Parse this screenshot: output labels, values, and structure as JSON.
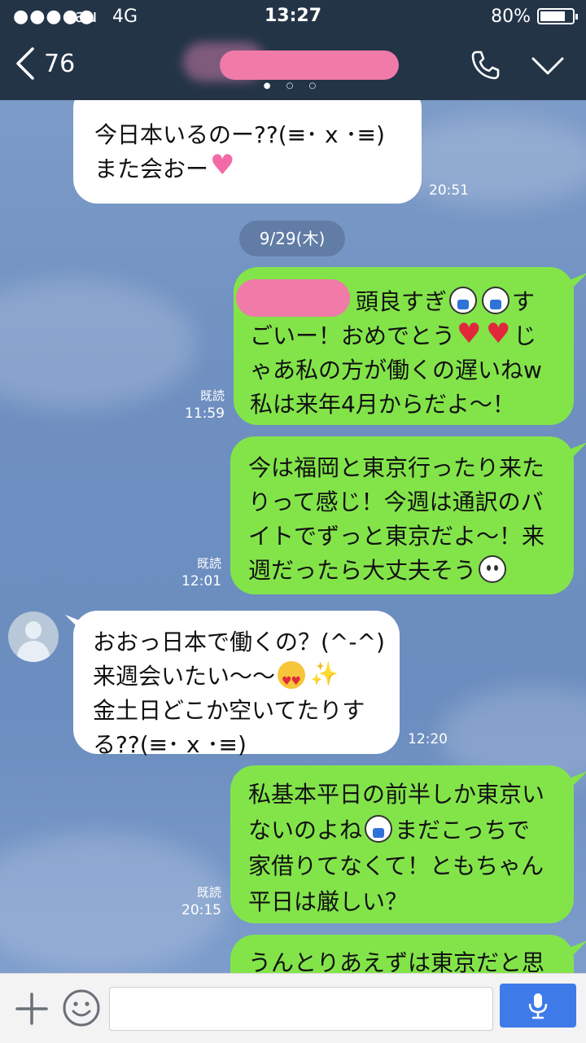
{
  "status_bar": {
    "signal": "●●●●●",
    "carrier": "au",
    "network": "4G",
    "time": "13:27",
    "battery_percent_label": "80%",
    "battery_level": 0.8
  },
  "nav": {
    "back_count": "76",
    "page_dots": "● ○ ○"
  },
  "chat": {
    "messages": [
      {
        "direction": "in",
        "lines": [
          "今日本いるのー??(≡･ x ･≡)",
          "また会おー"
        ],
        "time": "20:51"
      },
      {
        "type": "date",
        "label": "9/29(木)"
      },
      {
        "direction": "out",
        "lines": [
          "頭良すぎ",
          "す",
          "ごいー！おめでとう",
          "じ",
          "ゃあ私の方が働くの遅いねw",
          "私は来年4月からだよ〜！"
        ],
        "read": "既読",
        "time": "11:59"
      },
      {
        "direction": "out",
        "lines": [
          "今は福岡と東京行ったり来た",
          "りって感じ！今週は通訳のバ",
          "イトでずっと東京だよ〜！来",
          "週だったら大丈夫そう"
        ],
        "read": "既読",
        "time": "12:01"
      },
      {
        "direction": "in",
        "lines": [
          "おおっ日本で働くの？(^-^)",
          "来週会いたい〜〜",
          "金土日どこか空いてたりす",
          "る??(≡･ x ･≡)"
        ],
        "time": "12:20"
      },
      {
        "direction": "out",
        "lines": [
          "私基本平日の前半しか東京い",
          "ないのよね",
          "まだこっちで",
          "家借りてなくて！ともちゃん",
          "平日は厳しい？"
        ],
        "read": "既読",
        "time": "20:15"
      },
      {
        "direction": "out",
        "lines": [
          "うんとりあえずは東京だと思"
        ]
      }
    ]
  },
  "input_bar": {
    "placeholder": ""
  },
  "colors": {
    "header": "#243447",
    "bubble_out": "#83e44a",
    "bubble_in": "#ffffff",
    "mic_button": "#3f7be8"
  },
  "icons": [
    "back-chevron-icon",
    "phone-icon",
    "chevron-down-icon",
    "plus-icon",
    "emoji-icon",
    "microphone-icon"
  ]
}
